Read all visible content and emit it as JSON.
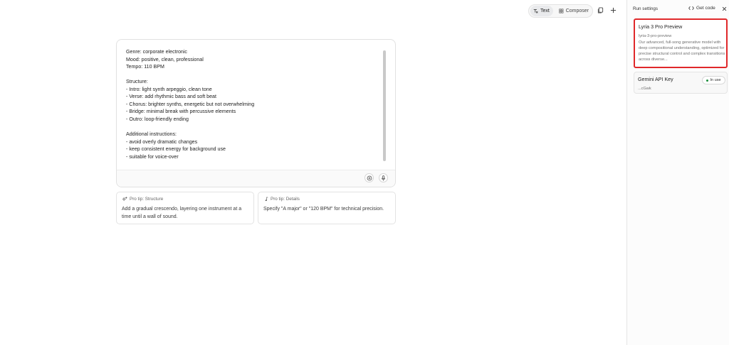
{
  "toolbar": {
    "mode_text": "Text",
    "mode_composer": "Composer"
  },
  "prompt": {
    "text": "Genre: corporate electronic\nMood: positive, clean, professional\nTempo: 110 BPM\n\nStructure:\n- Intro: light synth arpeggio, clean tone\n- Verse: add rhythmic bass and soft beat\n- Chorus: brighter synths, energetic but not overwhelming\n- Bridge: minimal break with percussive elements\n- Outro: loop-friendly ending\n\nAdditional instructions:\n- avoid overly dramatic changes\n- keep consistent energy for background use\n- suitable for voice-over"
  },
  "tips": [
    {
      "title": "Pro tip: Structure",
      "body": "Add a gradual crescendo, layering one instrument at a time until a wall of sound."
    },
    {
      "title": "Pro tip: Details",
      "body": "Specify \"A major\" or \"120 BPM\" for technical precision."
    }
  ],
  "panel": {
    "title": "Run settings",
    "get_code": "Get code",
    "model": {
      "name": "Lyria 3 Pro Preview",
      "id": "lyria-3-pro-preview",
      "description": "Our advanced, full-song generative model with deep compositional understanding, optimized for precise structural control and complex transitions across diverse..."
    },
    "api_key": {
      "label": "Gemini API Key",
      "value": "...cGwk",
      "status": "In use"
    }
  },
  "colors": {
    "selected_border": "#e0282a",
    "status_dot": "#1e8e3e"
  }
}
